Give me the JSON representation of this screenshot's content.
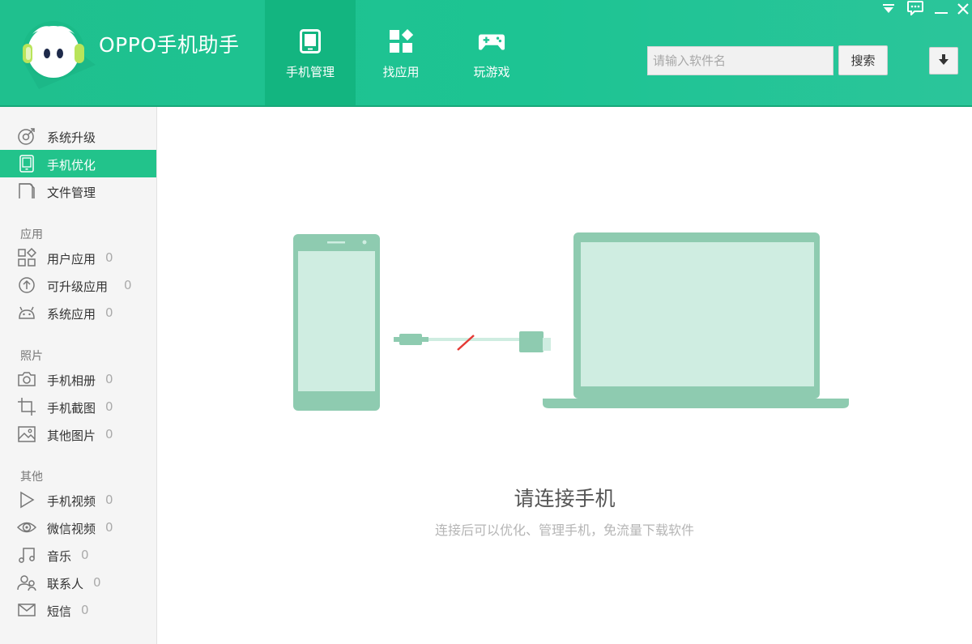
{
  "app": {
    "title": "OPPO手机助手"
  },
  "nav": {
    "tabs": [
      {
        "label": "手机管理",
        "icon": "phone-icon",
        "active": true
      },
      {
        "label": "找应用",
        "icon": "apps-grid-icon",
        "active": false
      },
      {
        "label": "玩游戏",
        "icon": "gamepad-icon",
        "active": false
      }
    ]
  },
  "search": {
    "placeholder": "请输入软件名",
    "button_label": "搜索"
  },
  "window_controls": [
    "dropdown-menu-icon",
    "feedback-icon",
    "minimize-icon",
    "close-icon"
  ],
  "sidebar": {
    "top_items": [
      {
        "label": "系统升级",
        "icon": "system-upgrade-icon"
      },
      {
        "label": "手机优化",
        "icon": "phone-optimize-icon",
        "active": true
      },
      {
        "label": "文件管理",
        "icon": "folder-icon"
      }
    ],
    "sections": [
      {
        "title": "应用",
        "items": [
          {
            "label": "用户应用",
            "count": "0",
            "icon": "user-apps-icon"
          },
          {
            "label": "可升级应用",
            "count": "0",
            "icon": "upgradable-apps-icon"
          },
          {
            "label": "系统应用",
            "count": "0",
            "icon": "android-icon"
          }
        ]
      },
      {
        "title": "照片",
        "items": [
          {
            "label": "手机相册",
            "count": "0",
            "icon": "camera-icon"
          },
          {
            "label": "手机截图",
            "count": "0",
            "icon": "crop-icon"
          },
          {
            "label": "其他图片",
            "count": "0",
            "icon": "image-icon"
          }
        ]
      },
      {
        "title": "其他",
        "items": [
          {
            "label": "手机视频",
            "count": "0",
            "icon": "play-icon"
          },
          {
            "label": "微信视频",
            "count": "0",
            "icon": "eye-icon"
          },
          {
            "label": "音乐",
            "count": "0",
            "icon": "music-icon"
          },
          {
            "label": "联系人",
            "count": "0",
            "icon": "contacts-icon"
          },
          {
            "label": "短信",
            "count": "0",
            "icon": "mail-icon"
          }
        ]
      }
    ]
  },
  "main": {
    "title": "请连接手机",
    "subtitle": "连接后可以优化、管理手机，免流量下载软件"
  },
  "colors": {
    "brand": "#1fc08e",
    "active_tab": "#13b580",
    "sidebar_active": "#22c38b",
    "illustration": "#8ecbb0",
    "illustration_light": "#cfede1",
    "disconnect": "#e53935"
  }
}
